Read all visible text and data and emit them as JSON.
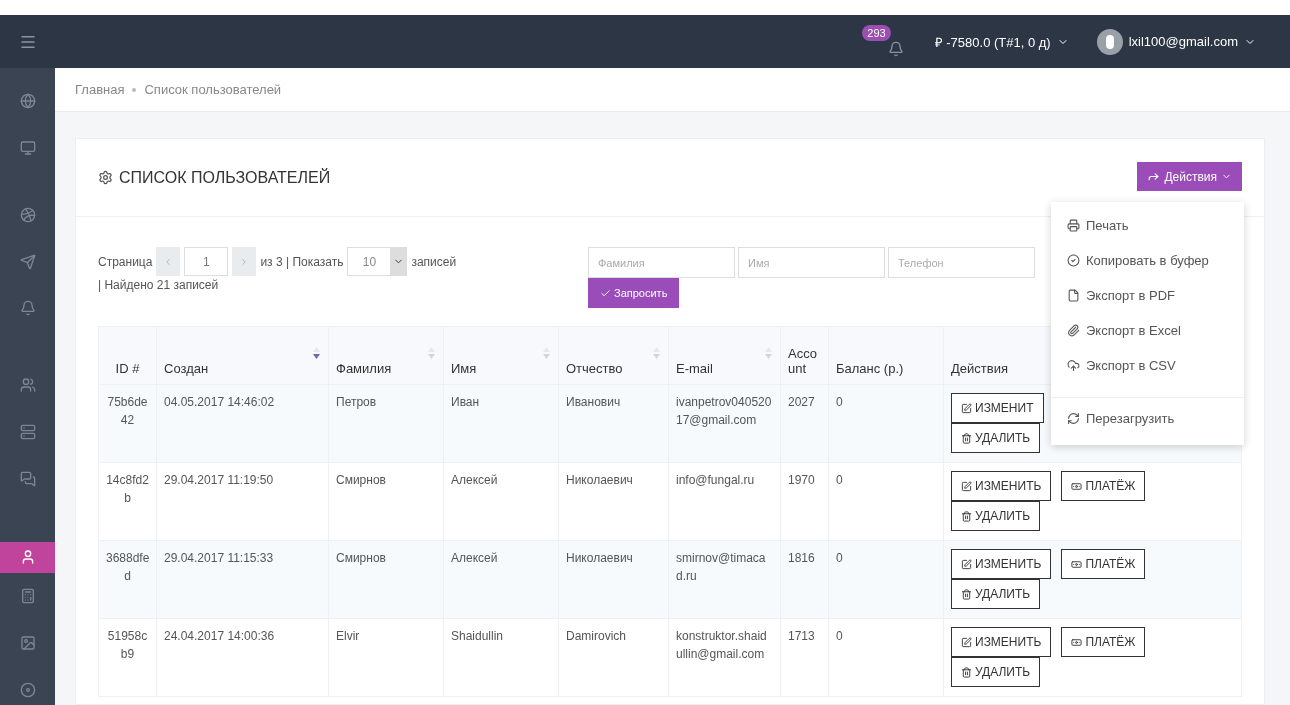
{
  "topbar": {
    "notifications_count": "293",
    "balance": "₽ -7580.0 (Т#1, 0 д)",
    "user_email": "lxil100@gmail.com"
  },
  "sidebar": {
    "items": [
      {
        "kind": "globe",
        "selected": false
      },
      {
        "kind": "monitor",
        "selected": false
      },
      {
        "kind": "ball",
        "selected": false
      },
      {
        "kind": "send",
        "selected": false
      },
      {
        "kind": "bell",
        "selected": false
      },
      {
        "kind": "people",
        "selected": false
      },
      {
        "kind": "server",
        "selected": false
      },
      {
        "kind": "chat",
        "selected": false
      },
      {
        "kind": "user",
        "selected": true
      },
      {
        "kind": "calculator",
        "selected": false
      },
      {
        "kind": "picture",
        "selected": false
      },
      {
        "kind": "disc",
        "selected": false
      }
    ]
  },
  "breadcrumb": [
    "Главная",
    "Список пользователей"
  ],
  "panel": {
    "title": "СПИСОК ПОЛЬЗОВАТЕЛЕЙ",
    "actions_button": "Действия",
    "actions_menu": [
      {
        "kind": "print",
        "label": "Печать"
      },
      {
        "kind": "copy",
        "label": "Копировать в буфер"
      },
      {
        "kind": "pdf",
        "label": "Экспорт в PDF"
      },
      {
        "kind": "excel",
        "label": "Экспорт в Excel"
      },
      {
        "kind": "csv",
        "label": "Экспорт в CSV"
      },
      {
        "kind": "reload",
        "label": "Перезагрузить"
      }
    ]
  },
  "pager": {
    "page_label": "Страница",
    "page": "1",
    "of_label": "из 3 | Показать",
    "per_page": "10",
    "records_label": "записей",
    "found": "| Найдено 21 записей"
  },
  "filters": [
    {
      "placeholder": "Фамилия"
    },
    {
      "placeholder": "Имя"
    },
    {
      "placeholder": "Телефон"
    }
  ],
  "query_button": "Запросить",
  "table": {
    "columns": [
      {
        "label": "ID #",
        "sortable": false,
        "sorted": false
      },
      {
        "label": "Создан",
        "sortable": true,
        "sorted": true
      },
      {
        "label": "Фамилия",
        "sortable": true,
        "sorted": false
      },
      {
        "label": "Имя",
        "sortable": true,
        "sorted": false
      },
      {
        "label": "Отчество",
        "sortable": true,
        "sorted": false
      },
      {
        "label": "E-mail",
        "sortable": true,
        "sorted": false
      },
      {
        "label": "Acco unt",
        "sortable": false,
        "sorted": false
      },
      {
        "label": "Баланс (р.)",
        "sortable": false,
        "sorted": false
      },
      {
        "label": "Действия"
      }
    ],
    "rows": [
      {
        "cells": [
          "75b6de 42",
          "04.05.2017 14:46:02",
          "Петров",
          "Иван",
          "Иванович",
          "ivanpetrov04052017@gmail.com",
          "2027",
          "0"
        ],
        "actions": [
          {
            "kind": "edit",
            "label": "ИЗМЕНИТ"
          },
          {
            "kind": "delete",
            "label": "УДАЛИТЬ"
          }
        ]
      },
      {
        "cells": [
          "14c8fd2 b",
          "29.04.2017 11:19:50",
          "Смирнов",
          "Алексей",
          "Николаевич",
          "info@fungal.ru",
          "1970",
          "0"
        ],
        "actions": [
          {
            "kind": "edit",
            "label": "ИЗМЕНИТЬ"
          },
          {
            "kind": "payment",
            "label": "ПЛАТЁЖ"
          },
          {
            "kind": "delete",
            "label": "УДАЛИТЬ"
          }
        ]
      },
      {
        "cells": [
          "3688dfe d",
          "29.04.2017 11:15:33",
          "Смирнов",
          "Алексей",
          "Николаевич",
          "smirnov@timacad.ru",
          "1816",
          "0"
        ],
        "actions": [
          {
            "kind": "edit",
            "label": "ИЗМЕНИТЬ"
          },
          {
            "kind": "payment",
            "label": "ПЛАТЁЖ"
          },
          {
            "kind": "delete",
            "label": "УДАЛИТЬ"
          }
        ]
      },
      {
        "cells": [
          "51958c b9",
          "24.04.2017 14:00:36",
          "Elvir",
          "Shaidullin",
          "Damirovich",
          "konstruktor.shaidullin@gmail.com",
          "1713",
          "0"
        ],
        "actions": [
          {
            "kind": "edit",
            "label": "ИЗМЕНИТЬ"
          },
          {
            "kind": "payment",
            "label": "ПЛАТЁЖ"
          },
          {
            "kind": "delete",
            "label": "УДАЛИТЬ"
          }
        ]
      }
    ]
  }
}
